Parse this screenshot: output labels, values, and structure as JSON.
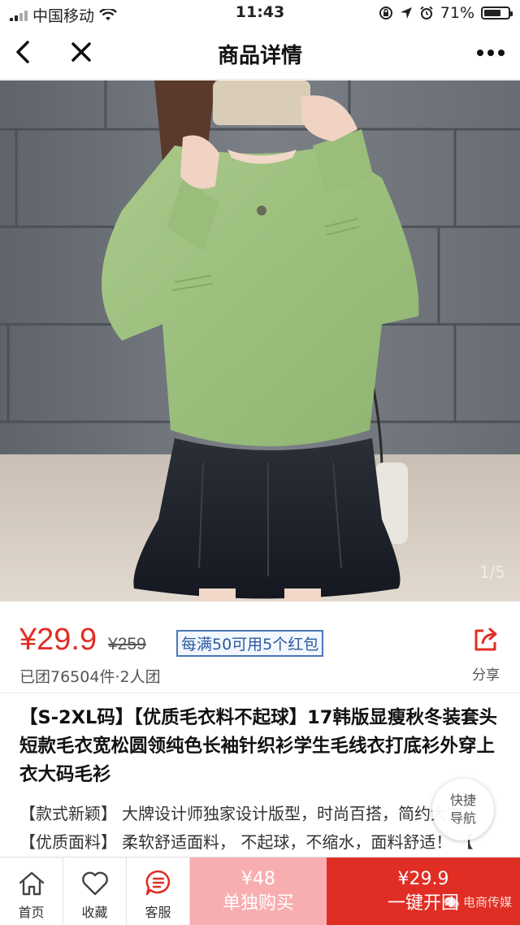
{
  "status_bar": {
    "carrier": "中国移动",
    "time": "11:43",
    "battery": "71%",
    "battery_level": 0.71
  },
  "nav": {
    "title": "商品详情",
    "icons": [
      "back-arrow-icon",
      "close-icon",
      "more-dots-icon"
    ]
  },
  "gallery": {
    "counter": "1/5"
  },
  "price": {
    "current": "¥29.9",
    "original": "¥259",
    "promo": "每满50可用5个红包",
    "sold": "已团76504件·2人团",
    "share_label": "分享"
  },
  "product": {
    "title": "【S-2XL码】【优质毛衣料不起球】17韩版显瘦秋冬装套头短款毛衣宽松圆领纯色长袖针织衫学生毛线衣打底衫外穿上衣大码毛衫",
    "desc": [
      {
        "tag": "【款式新颖】",
        "text": "大牌设计师独家设计版型，时尚百搭，简约大方"
      },
      {
        "tag": "【优质面料】",
        "text": "柔软舒适面料， 不起球，不缩水，面料舒适！ 【"
      }
    ]
  },
  "quick_nav": {
    "line1": "快捷",
    "line2": "导航"
  },
  "bottom_bar": {
    "home_label": "首页",
    "favorite_label": "收藏",
    "service_label": "客服",
    "buy_alone_price": "¥48",
    "buy_alone_label": "单独购买",
    "group_price": "¥29.9",
    "group_label": "一键开团",
    "watermark": "电商传媒"
  },
  "colors": {
    "accent": "#e02e24",
    "buy_alone_bg": "#f8aeb0",
    "promo_border": "#4a78b8"
  }
}
